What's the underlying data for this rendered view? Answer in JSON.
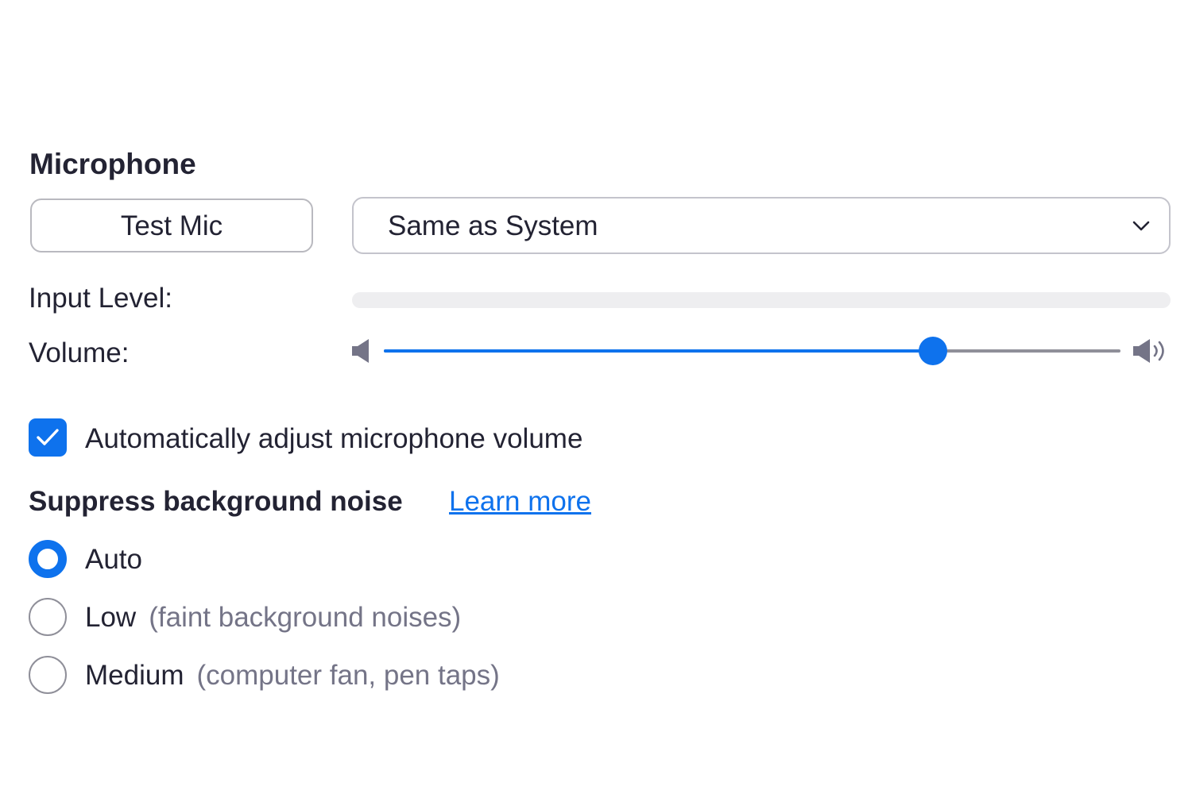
{
  "microphone": {
    "title": "Microphone",
    "test_button_label": "Test Mic",
    "device_select": {
      "selected": "Same as System",
      "icon": "chevron-down-icon"
    },
    "input_level": {
      "label": "Input Level:",
      "level": 0
    },
    "volume": {
      "label": "Volume:",
      "value_fraction": 0.745,
      "low_icon": "volume-low-icon",
      "high_icon": "volume-high-icon"
    },
    "auto_adjust": {
      "label": "Automatically adjust microphone volume",
      "checked": true
    }
  },
  "noise_suppression": {
    "title": "Suppress background noise",
    "learn_more_label": "Learn more",
    "options": [
      {
        "label": "Auto",
        "hint": "",
        "selected": true
      },
      {
        "label": "Low",
        "hint": "(faint background noises)",
        "selected": false
      },
      {
        "label": "Medium",
        "hint": "(computer fan, pen taps)",
        "selected": false
      }
    ]
  },
  "colors": {
    "accent": "#0e72ed",
    "text": "#232333",
    "muted": "#747487",
    "track": "#8f8f99",
    "level_track": "#eeeef0"
  }
}
